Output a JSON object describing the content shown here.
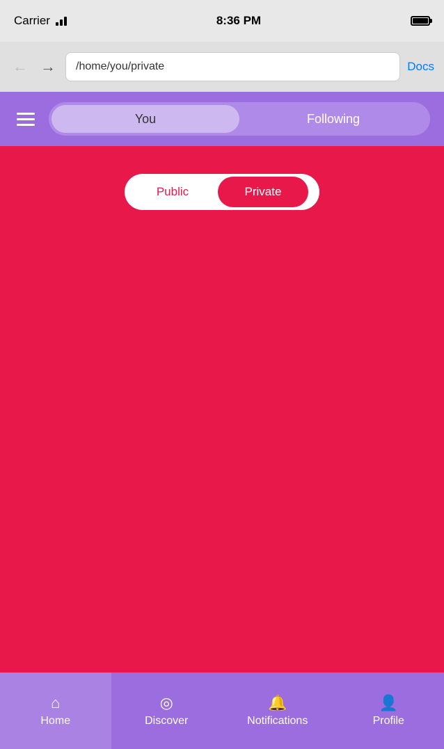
{
  "statusBar": {
    "carrier": "Carrier",
    "time": "8:36 PM"
  },
  "browserBar": {
    "url": "/home/you/private",
    "docsLabel": "Docs"
  },
  "topNav": {
    "youTab": "You",
    "followingTab": "Following",
    "activeTab": "you"
  },
  "subTabs": {
    "publicLabel": "Public",
    "privateLabel": "Private",
    "activeTab": "private"
  },
  "bottomNav": {
    "homeLabel": "Home",
    "discoverLabel": "Discover",
    "notificationsLabel": "Notifications",
    "profileLabel": "Profile",
    "activeItem": "home"
  },
  "colors": {
    "purple": "#9b6dde",
    "lightPurple": "#b08ae8",
    "red": "#e8194a",
    "white": "#ffffff"
  }
}
